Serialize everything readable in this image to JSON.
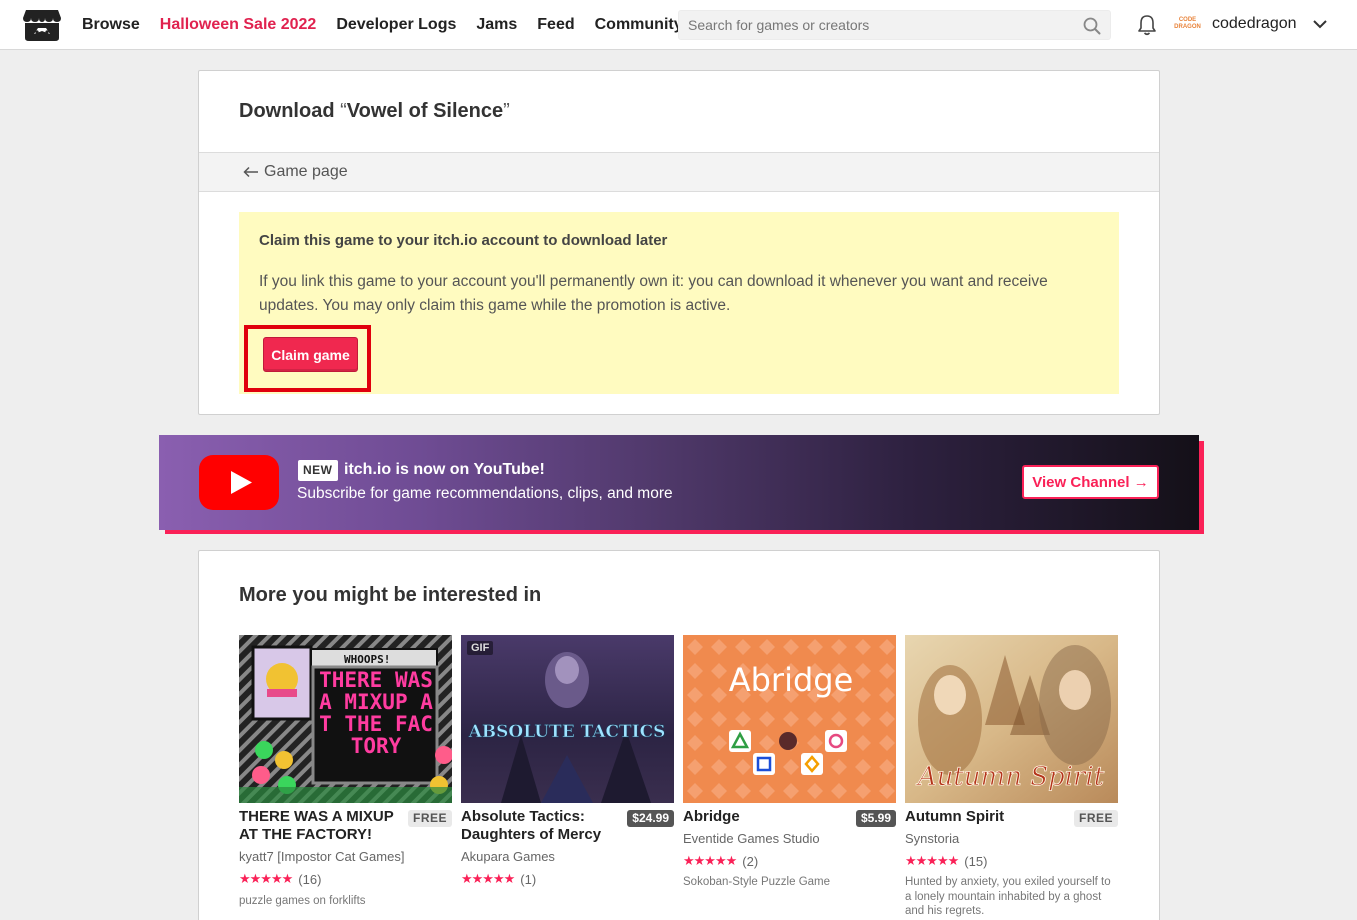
{
  "header": {
    "nav": [
      "Browse",
      "Halloween Sale 2022",
      "Developer Logs",
      "Jams",
      "Feed",
      "Community"
    ],
    "search_placeholder": "Search for games or creators",
    "avatar_text": "CODE DRAGON",
    "username": "codedragon",
    "colors": {
      "sale": "#e0224f"
    }
  },
  "download": {
    "label": "Download",
    "quote_open": "“",
    "game": "Vowel of Silence",
    "quote_close": "”",
    "back_link": "Game page",
    "claim_title": "Claim this game to your itch.io account to download later",
    "claim_text": "If you link this game to your account you'll permanently own it: you can download it whenever you want and receive updates. You may only claim this game while the promotion is active.",
    "claim_button": "Claim game",
    "colors": {
      "claim_box": "#fffbc0",
      "claim_button": "#f0284f",
      "highlight": "#e0000d"
    }
  },
  "youtube": {
    "badge": "NEW",
    "headline": "itch.io is now on YouTube!",
    "sub": "Subscribe for game recommendations, clips, and more",
    "button": "View Channel →",
    "colors": {
      "accent": "#fa2157",
      "logo": "#ff0000"
    }
  },
  "recs": {
    "title": "More you might be interested in",
    "games": [
      {
        "title": "THERE WAS A MIXUP AT THE FACTORY!",
        "price": "FREE",
        "author": "kyatt7 [Impostor Cat Games]",
        "stars": "★★★★★",
        "rating_value": 4.5,
        "rating_count": "(16)",
        "desc": "puzzle games on forklifts",
        "gif": "",
        "thumb_text": "THERE WAS A MIXUP AT THE FACTORY",
        "thumb_top": "WHOOPS!"
      },
      {
        "title": "Absolute Tactics: Daughters of Mercy",
        "price": "$24.99",
        "author": "Akupara Games",
        "stars": "★★★★★",
        "rating_value": 5,
        "rating_count": "(1)",
        "desc": "",
        "gif": "GIF",
        "thumb_text": "ABSOLUTE TACTICS",
        "thumb_top": ""
      },
      {
        "title": "Abridge",
        "price": "$5.99",
        "author": "Eventide Games Studio",
        "stars": "★★★★★",
        "rating_value": 5,
        "rating_count": "(2)",
        "desc": "Sokoban-Style Puzzle Game",
        "gif": "",
        "thumb_text": "Abridge",
        "thumb_top": ""
      },
      {
        "title": "Autumn Spirit",
        "price": "FREE",
        "author": "Synstoria",
        "stars": "★★★★★",
        "rating_value": 5,
        "rating_count": "(15)",
        "desc": "Hunted by anxiety, you exiled yourself to a lonely mountain inhabited by a ghost and his regrets.",
        "gif": "",
        "thumb_text": "Autumn Spirit",
        "thumb_top": ""
      }
    ]
  }
}
